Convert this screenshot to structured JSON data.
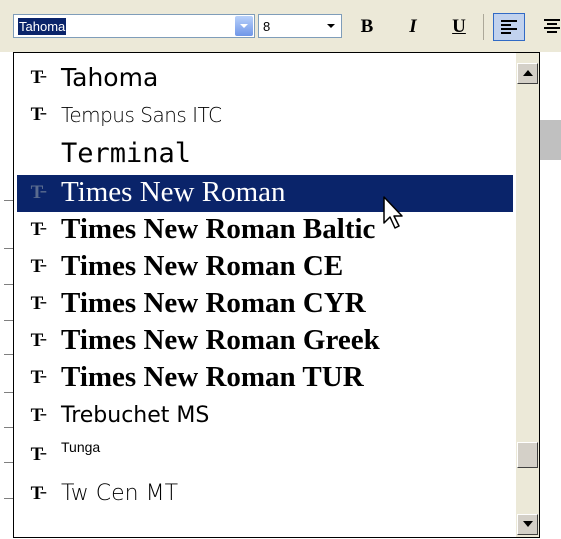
{
  "toolbar": {
    "font_name_value": "Tahoma",
    "font_size_value": "8",
    "bold_label": "B",
    "italic_label": "I",
    "underline_label": "U"
  },
  "font_list": {
    "items": [
      {
        "icon": "truetype-icon",
        "label": "Tahoma",
        "selected": false
      },
      {
        "icon": "truetype-icon",
        "label": "Tempus Sans ITC",
        "selected": false
      },
      {
        "icon": "",
        "label": "Terminal",
        "selected": false
      },
      {
        "icon": "truetype-icon",
        "label": "Times New Roman",
        "selected": true
      },
      {
        "icon": "truetype-icon",
        "label": "Times New Roman Baltic",
        "selected": false
      },
      {
        "icon": "truetype-icon",
        "label": "Times New Roman CE",
        "selected": false
      },
      {
        "icon": "truetype-icon",
        "label": "Times New Roman CYR",
        "selected": false
      },
      {
        "icon": "truetype-icon",
        "label": "Times New Roman Greek",
        "selected": false
      },
      {
        "icon": "truetype-icon",
        "label": "Times New Roman TUR",
        "selected": false
      },
      {
        "icon": "truetype-icon",
        "label": "Trebuchet MS",
        "selected": false
      },
      {
        "icon": "truetype-icon",
        "label": "Tunga",
        "selected": false
      },
      {
        "icon": "truetype-icon",
        "label": "Tw Cen MT",
        "selected": false
      }
    ],
    "truetype_glyph": "T̵"
  },
  "colors": {
    "selection_bg": "#0a246a",
    "selection_fg": "#ffffff",
    "toolbar_bg": "#ece9d8",
    "combo_border": "#7f9db9"
  }
}
